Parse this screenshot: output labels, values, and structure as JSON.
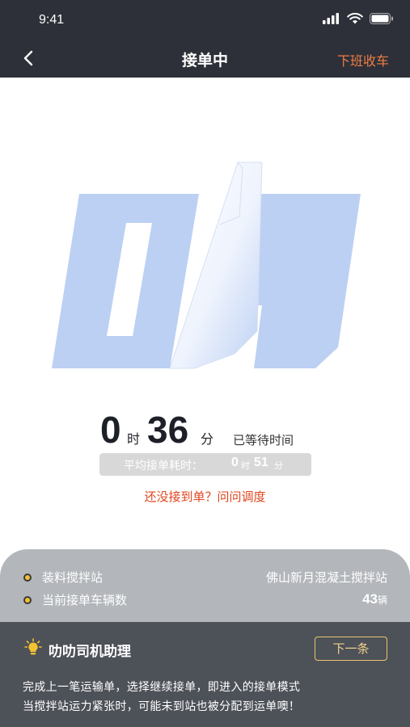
{
  "status_bar": {
    "time": "9:41"
  },
  "nav": {
    "title": "接单中",
    "action": "下班收车"
  },
  "timer": {
    "hours": "0",
    "hours_unit": "时",
    "minutes": "36",
    "minutes_unit": "分",
    "waited_label": "已等待时间"
  },
  "average": {
    "label": "平均接单耗时：",
    "hours": "0",
    "hours_unit": "时",
    "minutes": "51",
    "minutes_unit": "分"
  },
  "ask_link": "还没接到单？问问调度",
  "info": {
    "station_label": "装料搅拌站",
    "station_value": "佛山新月混凝土搅拌站",
    "vehicles_label": "当前接单车辆数",
    "vehicles_count": "43",
    "vehicles_unit": "辆"
  },
  "assistant": {
    "title": "叻叻司机助理",
    "next_label": "下一条",
    "line1": "完成上一笔运输单，选择继续接单，即进入的接单模式",
    "line2": "当搅拌站运力紧张时，可能未到站也被分配到运单噢！"
  },
  "colors": {
    "header_bg": "#2d3038",
    "accent_orange": "#f07d45",
    "link_red": "#e0461f",
    "logo_blue": "#bcd0f3",
    "assistant_bg": "#4d5158",
    "button_gold": "#e8c56c"
  },
  "icons": [
    "back-arrow-icon",
    "signal-icon",
    "wifi-icon",
    "battery-icon",
    "logo-mark",
    "lightbulb-icon",
    "bullet-dot-icon"
  ]
}
